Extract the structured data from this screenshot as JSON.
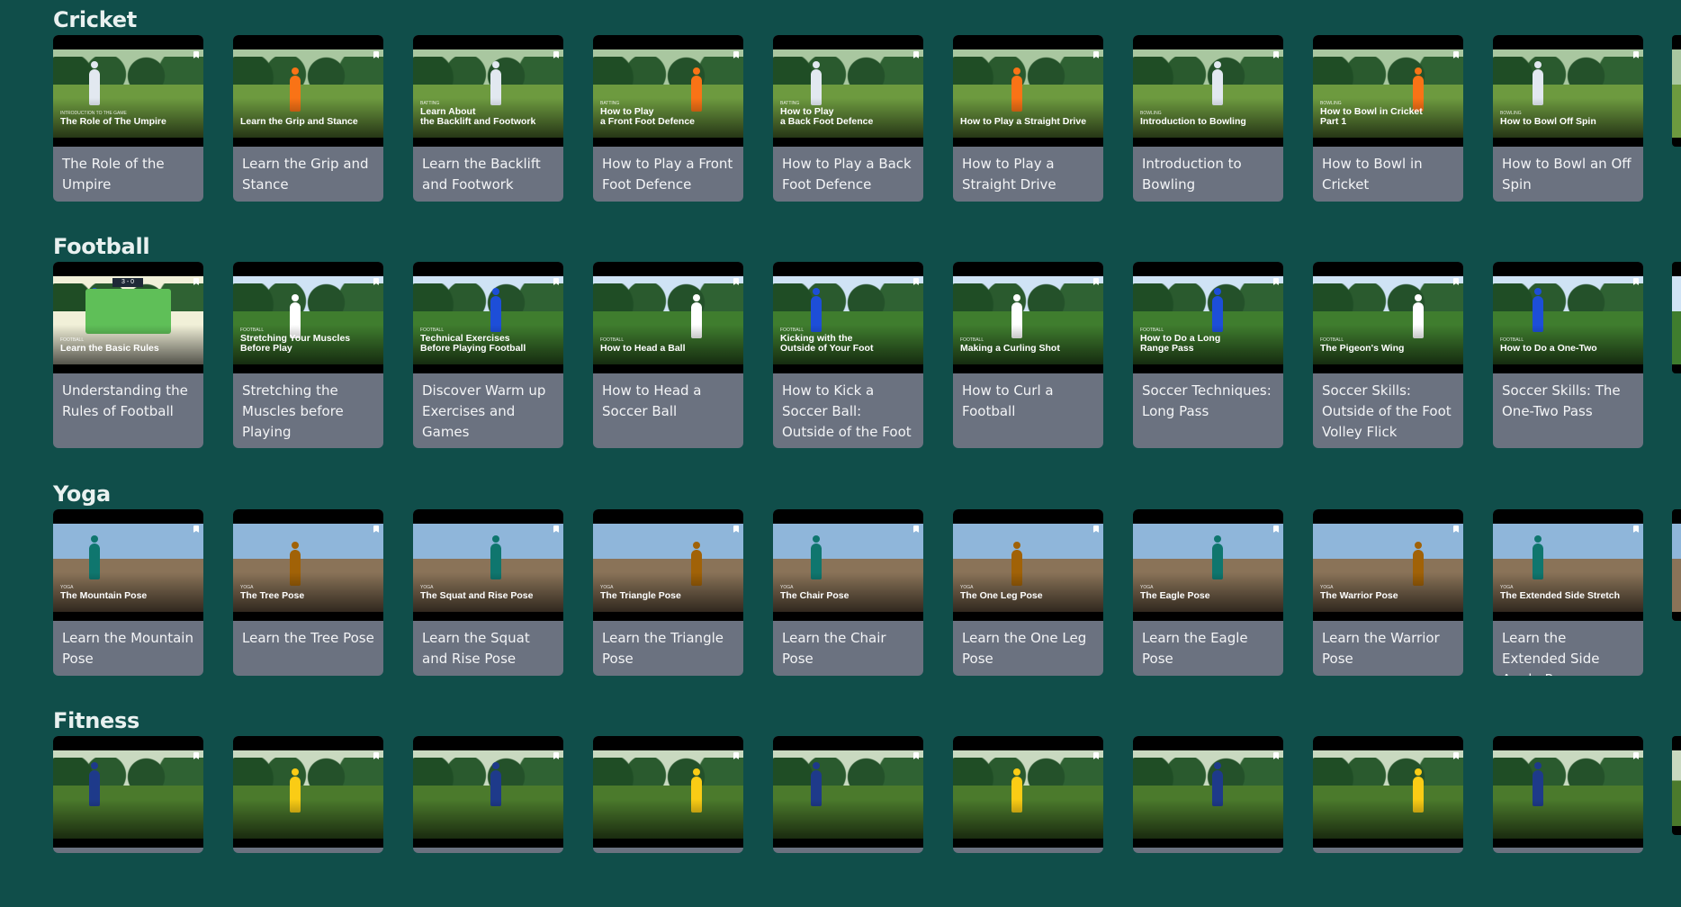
{
  "sections": [
    {
      "title": "Cricket",
      "scene": {
        "sky": "#a9c7a0",
        "ground": "#6d9a3f",
        "fig": "#e2e8f0",
        "accent": "#f97316"
      },
      "cards": [
        {
          "kicker": "Introduction to the game",
          "thumb": "The Role of The Umpire",
          "title": "The Role of the Umpire"
        },
        {
          "kicker": "",
          "thumb": "Learn the Grip and Stance",
          "title": "Learn the Grip and Stance"
        },
        {
          "kicker": "Batting",
          "thumb": "Learn About\nthe Backlift and Footwork",
          "title": "Learn the Backlift and Footwork"
        },
        {
          "kicker": "Batting",
          "thumb": "How to Play\na Front Foot Defence",
          "title": "How to Play a Front Foot Defence"
        },
        {
          "kicker": "Batting",
          "thumb": "How to Play\na Back Foot Defence",
          "title": "How to Play a Back Foot Defence"
        },
        {
          "kicker": "",
          "thumb": "How to Play a Straight Drive",
          "title": "How to Play a Straight Drive"
        },
        {
          "kicker": "Bowling",
          "thumb": "Introduction to Bowling",
          "title": "Introduction to Bowling"
        },
        {
          "kicker": "Bowling",
          "thumb": "How to Bowl in Cricket\nPart 1",
          "title": "How to Bowl in Cricket"
        },
        {
          "kicker": "Bowling",
          "thumb": "How to Bowl Off Spin",
          "title": "How to Bowl an Off Spin"
        }
      ]
    },
    {
      "title": "Football",
      "scene": {
        "sky": "#cfe3f5",
        "ground": "#3f7d2e",
        "fig": "#1d4ed8",
        "accent": "#ffffff"
      },
      "cards": [
        {
          "kicker": "Football",
          "thumb": "Learn the Basic Rules",
          "title": "Understanding the Rules of Football",
          "score": "3 - 0"
        },
        {
          "kicker": "Football",
          "thumb": "Stretching Your Muscles\nBefore Play",
          "title": "Stretching the Muscles before Playing"
        },
        {
          "kicker": "Football",
          "thumb": "Technical Exercises\nBefore Playing Football",
          "title": "Discover Warm up Exercises and Games"
        },
        {
          "kicker": "Football",
          "thumb": "How to Head a Ball",
          "title": "How to Head a Soccer Ball"
        },
        {
          "kicker": "Football",
          "thumb": "Kicking with the\nOutside of Your Foot",
          "title": "How to Kick a Soccer Ball: Outside of the Foot"
        },
        {
          "kicker": "Football",
          "thumb": "Making a Curling Shot",
          "title": "How to Curl a Football"
        },
        {
          "kicker": "Football",
          "thumb": "How to Do a Long\nRange Pass",
          "title": "Soccer Techniques: Long Pass"
        },
        {
          "kicker": "Football",
          "thumb": "The Pigeon's Wing",
          "title": "Soccer Skills: Outside of the Foot Volley Flick"
        },
        {
          "kicker": "Football",
          "thumb": "How to Do a One-Two",
          "title": "Soccer Skills: The One-Two Pass"
        }
      ]
    },
    {
      "title": "Yoga",
      "scene": {
        "sky": "#8fb6da",
        "ground": "#8a7358",
        "fig": "#0f766e",
        "accent": "#a16207"
      },
      "cards": [
        {
          "kicker": "Yoga",
          "thumb": "The Mountain Pose",
          "title": "Learn the Mountain Pose"
        },
        {
          "kicker": "Yoga",
          "thumb": "The Tree Pose",
          "title": "Learn the Tree Pose"
        },
        {
          "kicker": "Yoga",
          "thumb": "The Squat and Rise Pose",
          "title": "Learn the Squat and Rise Pose"
        },
        {
          "kicker": "Yoga",
          "thumb": "The Triangle Pose",
          "title": "Learn the Triangle Pose"
        },
        {
          "kicker": "Yoga",
          "thumb": "The Chair Pose",
          "title": "Learn the Chair Pose"
        },
        {
          "kicker": "Yoga",
          "thumb": "The One Leg Pose",
          "title": "Learn the One Leg Pose"
        },
        {
          "kicker": "Yoga",
          "thumb": "The Eagle Pose",
          "title": "Learn the Eagle Pose"
        },
        {
          "kicker": "Yoga",
          "thumb": "The Warrior Pose",
          "title": "Learn the Warrior Pose"
        },
        {
          "kicker": "Yoga",
          "thumb": "The Extended Side Stretch",
          "title": "Learn the Extended Side Angle Pose"
        }
      ]
    },
    {
      "title": "Fitness",
      "scene": {
        "sky": "#c9d9c0",
        "ground": "#4b7a2c",
        "fig": "#1e3a8a",
        "accent": "#facc15"
      },
      "cards": [
        {
          "kicker": "",
          "thumb": "",
          "title": ""
        },
        {
          "kicker": "",
          "thumb": "",
          "title": ""
        },
        {
          "kicker": "",
          "thumb": "",
          "title": ""
        },
        {
          "kicker": "",
          "thumb": "",
          "title": ""
        },
        {
          "kicker": "",
          "thumb": "",
          "title": ""
        },
        {
          "kicker": "",
          "thumb": "",
          "title": ""
        },
        {
          "kicker": "",
          "thumb": "",
          "title": ""
        },
        {
          "kicker": "",
          "thumb": "",
          "title": ""
        },
        {
          "kicker": "",
          "thumb": "",
          "title": ""
        }
      ]
    }
  ]
}
